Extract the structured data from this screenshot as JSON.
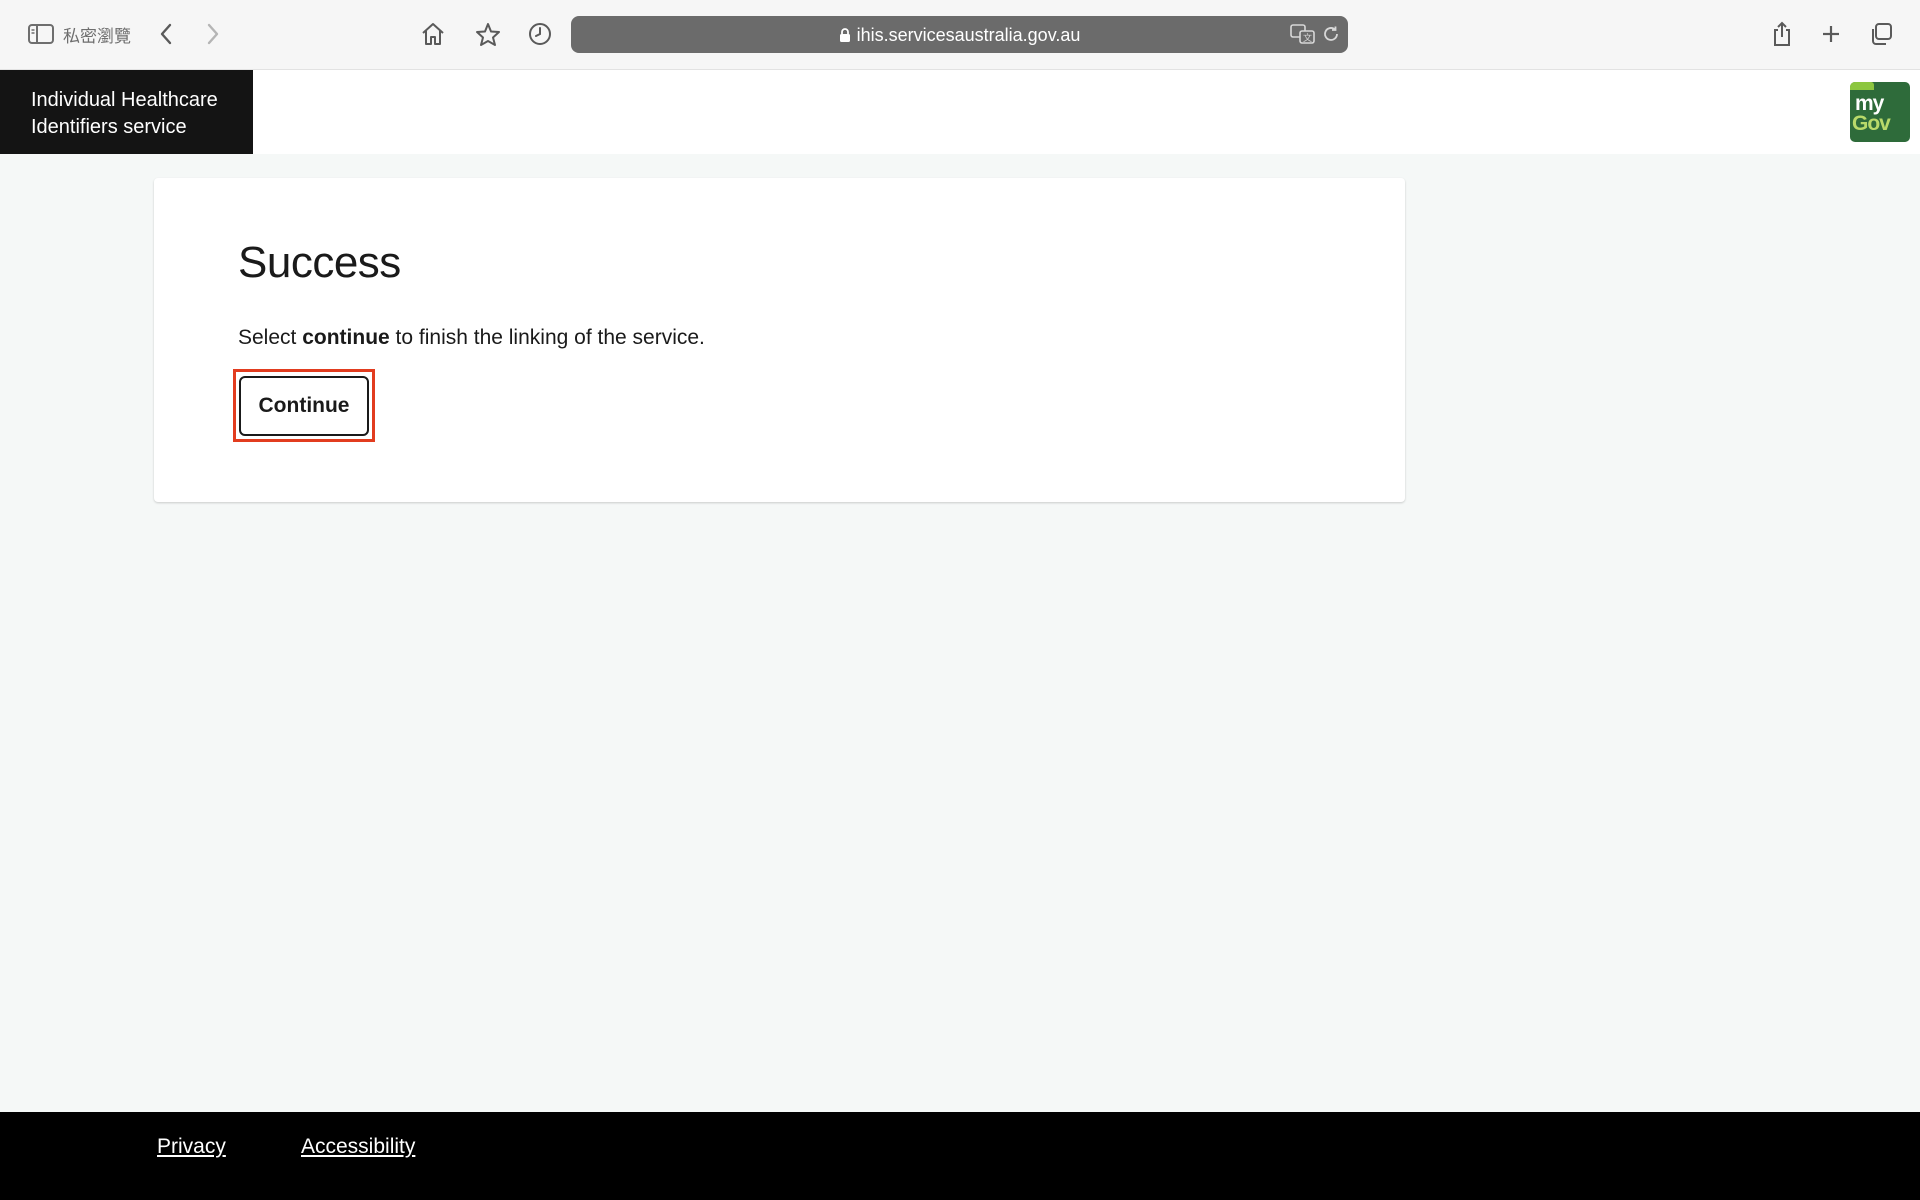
{
  "browser": {
    "private_label": "私密瀏覽",
    "url": "ihis.servicesaustralia.gov.au"
  },
  "site": {
    "brand_line1": "Individual Healthcare",
    "brand_line2": "Identifiers service",
    "logo_my": "my",
    "logo_gov": "Gov"
  },
  "card": {
    "title": "Success",
    "message_before": "Select ",
    "message_bold": "continue",
    "message_after": " to finish the linking of the service.",
    "continue_label": "Continue"
  },
  "footer": {
    "privacy": "Privacy",
    "accessibility": "Accessibility"
  },
  "colors": {
    "page_bg": "#f5f8f7",
    "brand_bg": "#141414",
    "mygov_green": "#2e6b3a",
    "focus_ring": "#e23c1f",
    "footer_bg": "#000000"
  }
}
